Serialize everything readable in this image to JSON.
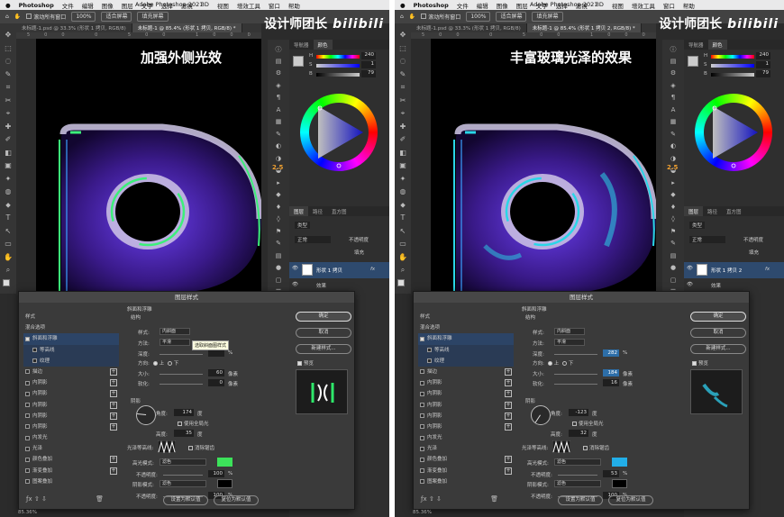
{
  "menubar": {
    "app": "Photoshop",
    "items": [
      "文件",
      "编辑",
      "图像",
      "图层",
      "文字",
      "选择",
      "滤镜",
      "3D",
      "视图",
      "增效工具",
      "窗口",
      "帮助"
    ],
    "window_title": "Adobe Photoshop 2021"
  },
  "options_bar": {
    "scroll_all": "滚动所有窗口",
    "zoom": "100%",
    "fit_screen": "适合屏幕",
    "fill_screen": "填充屏幕"
  },
  "brand": {
    "text": "设计师团长",
    "logo": "bilibili"
  },
  "status": {
    "zoom_left": "85.36%",
    "zoom_right": "85.36%"
  },
  "panels": [
    {
      "doc_tabs": [
        "未标题-1.psd @ 33.3% (形状 1 拷贝, RGB/8)",
        "未标题-1 @ 85.4% (形状 1 拷贝, RGB/8) *"
      ],
      "ruler": [
        "500",
        "0",
        "500",
        "1000",
        "1500",
        "2000"
      ],
      "overlay_title": "加强外侧光效",
      "color_panel": {
        "tabs": [
          "导航器",
          "颜色"
        ],
        "h": "240",
        "s": "1",
        "b": "79"
      },
      "layers_panel": {
        "tabs": [
          "图层",
          "路径",
          "直方图"
        ],
        "kind": "类型",
        "mode": "正常",
        "opacity_label": "不透明度",
        "fill_label": "填充",
        "layer_name": "形状 1 拷贝",
        "fx": "fx",
        "effects": "效果",
        "effect_item": "斜面和浮雕"
      },
      "dialog": {
        "title": "图层样式",
        "styles_header": "样式",
        "blend_options": "混合选项",
        "items": [
          {
            "label": "斜面和浮雕",
            "checked": true,
            "selected": true,
            "plus": false
          },
          {
            "label": "等高线",
            "checked": false,
            "sub": true,
            "plus": false
          },
          {
            "label": "纹理",
            "checked": false,
            "sub": true,
            "plus": false
          },
          {
            "label": "描边",
            "checked": false,
            "plus": true
          },
          {
            "label": "内阴影",
            "checked": false,
            "plus": true
          },
          {
            "label": "内阴影",
            "checked": false,
            "plus": true
          },
          {
            "label": "内阴影",
            "checked": false,
            "plus": true
          },
          {
            "label": "内阴影",
            "checked": false,
            "plus": true
          },
          {
            "label": "内阴影",
            "checked": false,
            "plus": true
          },
          {
            "label": "内发光",
            "checked": false,
            "plus": false
          },
          {
            "label": "光泽",
            "checked": false,
            "plus": false
          },
          {
            "label": "颜色叠加",
            "checked": false,
            "plus": true
          },
          {
            "label": "渐变叠加",
            "checked": false,
            "plus": true
          },
          {
            "label": "图案叠加",
            "checked": false,
            "plus": false
          }
        ],
        "section_bevel": "斜面和浮雕",
        "section_structure": "结构",
        "style_label": "样式:",
        "style_value": "内斜面",
        "method_label": "方法:",
        "method_value": "平滑",
        "depth_label": "深度:",
        "depth_value": "",
        "direction_label": "方向:",
        "dir_up": "上",
        "dir_down": "下",
        "size_label": "大小:",
        "size_value": "60",
        "size_unit": "像素",
        "soften_label": "软化:",
        "soften_value": "0",
        "soften_unit": "像素",
        "section_shading": "阴影",
        "angle_label": "角度:",
        "angle_value": "174",
        "angle_unit": "度",
        "global_light": "使用全局光",
        "altitude_label": "高度:",
        "altitude_value": "35",
        "altitude_unit": "度",
        "gloss_label": "光泽等高线:",
        "antialias": "消除锯齿",
        "highlight_mode_label": "高光模式:",
        "highlight_mode": "滤色",
        "highlight_color": "#3ce25a",
        "opacity_label": "不透明度:",
        "hl_opacity": "100",
        "shadow_mode_label": "阴影模式:",
        "shadow_mode": "滤色",
        "shadow_color": "#000000",
        "sh_opacity": "100",
        "pct": "%",
        "ok": "确定",
        "cancel": "取消",
        "new_style": "新建样式...",
        "preview": "预览",
        "set_default": "设置为默认值",
        "reset_default": "复位为默认值",
        "tooltip": "选取斜面图样式",
        "preview_color": "#2ee86a"
      }
    },
    {
      "doc_tabs": [
        "未标题-1.psd @ 33.3% (形状 1 拷贝, RGB/8)",
        "未标题-1 @ 85.4% (形状 1 拷贝 2, RGB/8) *"
      ],
      "ruler": [
        "500",
        "0",
        "500",
        "1000",
        "1500",
        "2000"
      ],
      "overlay_title": "丰富玻璃光泽的效果",
      "color_panel": {
        "tabs": [
          "导航器",
          "颜色"
        ],
        "h": "240",
        "s": "1",
        "b": "79"
      },
      "layers_panel": {
        "tabs": [
          "图层",
          "路径",
          "直方图"
        ],
        "kind": "类型",
        "mode": "正常",
        "opacity_label": "不透明度",
        "fill_label": "填充",
        "layer_name": "形状 1 拷贝 2",
        "fx": "fx",
        "effects": "效果",
        "effect_item": "斜面和浮雕"
      },
      "dialog": {
        "title": "图层样式",
        "styles_header": "样式",
        "blend_options": "混合选项",
        "items": [
          {
            "label": "斜面和浮雕",
            "checked": true,
            "selected": true,
            "plus": false
          },
          {
            "label": "等高线",
            "checked": false,
            "sub": true,
            "plus": false
          },
          {
            "label": "纹理",
            "checked": false,
            "sub": true,
            "plus": false
          },
          {
            "label": "描边",
            "checked": false,
            "plus": true
          },
          {
            "label": "内阴影",
            "checked": false,
            "plus": true
          },
          {
            "label": "内阴影",
            "checked": false,
            "plus": true
          },
          {
            "label": "内阴影",
            "checked": false,
            "plus": true
          },
          {
            "label": "内阴影",
            "checked": false,
            "plus": true
          },
          {
            "label": "内阴影",
            "checked": false,
            "plus": true
          },
          {
            "label": "内发光",
            "checked": false,
            "plus": false
          },
          {
            "label": "光泽",
            "checked": false,
            "plus": false
          },
          {
            "label": "颜色叠加",
            "checked": false,
            "plus": true
          },
          {
            "label": "渐变叠加",
            "checked": false,
            "plus": true
          },
          {
            "label": "图案叠加",
            "checked": false,
            "plus": false
          }
        ],
        "section_bevel": "斜面和浮雕",
        "section_structure": "结构",
        "style_label": "样式:",
        "style_value": "内斜面",
        "method_label": "方法:",
        "method_value": "平滑",
        "depth_label": "深度:",
        "depth_value": "282",
        "direction_label": "方向:",
        "dir_up": "上",
        "dir_down": "下",
        "size_label": "大小:",
        "size_value": "184",
        "size_unit": "像素",
        "soften_label": "软化:",
        "soften_value": "16",
        "soften_unit": "像素",
        "section_shading": "阴影",
        "angle_label": "角度:",
        "angle_value": "-123",
        "angle_unit": "度",
        "global_light": "使用全局光",
        "altitude_label": "高度:",
        "altitude_value": "32",
        "altitude_unit": "度",
        "gloss_label": "光泽等高线:",
        "antialias": "消除锯齿",
        "highlight_mode_label": "高光模式:",
        "highlight_mode": "滤色",
        "highlight_color": "#22aee8",
        "opacity_label": "不透明度:",
        "hl_opacity": "53",
        "shadow_mode_label": "阴影模式:",
        "shadow_mode": "滤色",
        "shadow_color": "#000000",
        "sh_opacity": "100",
        "pct": "%",
        "ok": "确定",
        "cancel": "取消",
        "new_style": "新建样式...",
        "preview": "预览",
        "set_default": "设置为默认值",
        "reset_default": "复位为默认值",
        "tooltip": "",
        "preview_color": "#2aa0b8"
      }
    }
  ]
}
